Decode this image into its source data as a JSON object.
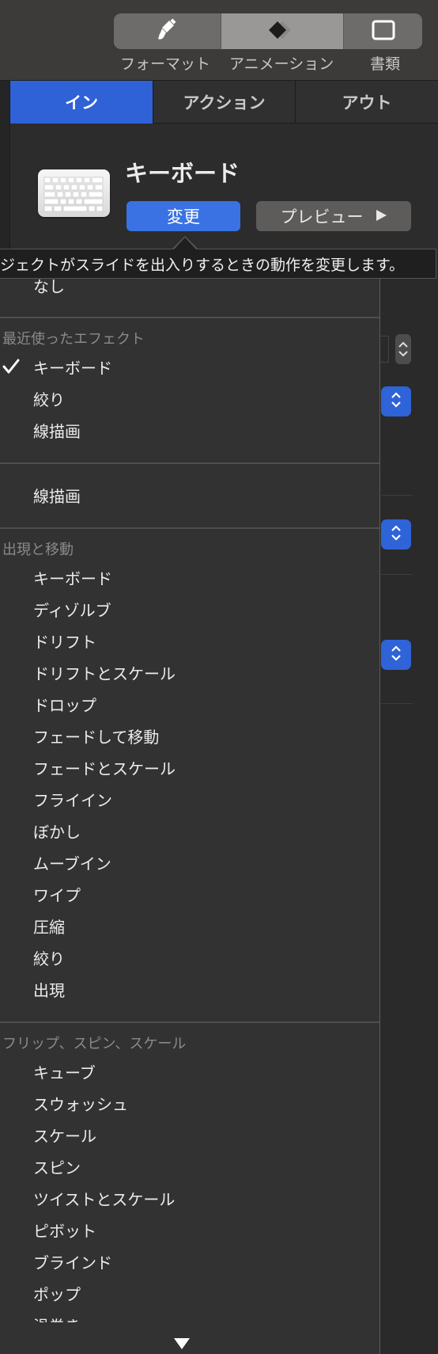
{
  "toolbar": {
    "format_label": "フォーマット",
    "animate_label": "アニメーション",
    "document_label": "書類",
    "icons": [
      "paintbrush-icon",
      "animate-diamonds-icon",
      "document-icon"
    ]
  },
  "tabs": {
    "build_in": "イン",
    "action": "アクション",
    "build_out": "アウト",
    "active": "イン"
  },
  "effect": {
    "name": "キーボード",
    "change_label": "変更",
    "preview_label": "プレビュー",
    "preview_icon": "play-triangle-icon"
  },
  "tooltip": {
    "text": "ジェクトがスライドを出入りするときの動作を変更します。"
  },
  "menu": {
    "none_label": "なし",
    "recent_header": "最近使ったエフェクト",
    "recent": [
      "キーボード",
      "絞り",
      "線描画"
    ],
    "checked_item": "キーボード",
    "single": "線描画",
    "appear_header": "出現と移動",
    "appear": [
      "キーボード",
      "ディゾルブ",
      "ドリフト",
      "ドリフトとスケール",
      "ドロップ",
      "フェードして移動",
      "フェードとスケール",
      "フライイン",
      "ぼかし",
      "ムーブイン",
      "ワイプ",
      "圧縮",
      "絞り",
      "出現"
    ],
    "flip_header": "フリップ、スピン、スケール",
    "flip": [
      "キューブ",
      "スウォッシュ",
      "スケール",
      "スピン",
      "ツイストとスケール",
      "ピボット",
      "ブラインド",
      "ポップ",
      "渦巻き"
    ]
  },
  "colors": {
    "accent_blue": "#2e62d6",
    "button_blue": "#3a72e3"
  }
}
